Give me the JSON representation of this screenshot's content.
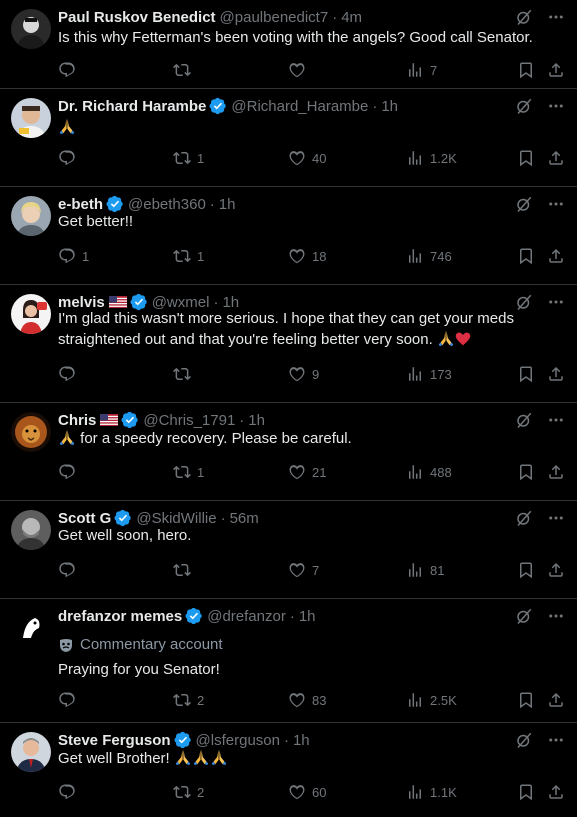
{
  "tweets": [
    {
      "name": "Paul Ruskov Benedict",
      "handle": "@paulbenedict7",
      "sep": "·",
      "time": "4m",
      "text": "Is this why Fetterman's been voting with the angels? Good call Senator.",
      "replies": "",
      "retweets": "",
      "likes": "",
      "views": "7",
      "verified": false
    },
    {
      "name": "Dr. Richard Harambe",
      "handle": "@Richard_Harambe",
      "sep": "·",
      "time": "1h",
      "text": "🙏",
      "replies": "",
      "retweets": "1",
      "likes": "40",
      "views": "1.2K",
      "verified": true
    },
    {
      "name": "e-beth",
      "handle": "@ebeth360",
      "sep": "·",
      "time": "1h",
      "text": "Get better!!",
      "replies": "1",
      "retweets": "1",
      "likes": "18",
      "views": "746",
      "verified": true
    },
    {
      "name": "melvis",
      "handle": "@wxmel",
      "sep": "·",
      "time": "1h",
      "text_line1": "I'm glad this wasn't more serious. I hope that they can get your meds",
      "text_line2": "straightened out and that you're feeling better very soon.",
      "replies": "",
      "retweets": "",
      "likes": "9",
      "views": "173",
      "verified": true
    },
    {
      "name": "Chris",
      "handle": "@Chris_1791",
      "sep": "·",
      "time": "1h",
      "text": "for a speedy recovery.  Please be careful.",
      "replies": "",
      "retweets": "1",
      "likes": "21",
      "views": "488",
      "verified": true
    },
    {
      "name": "Scott G",
      "handle": "@SkidWillie",
      "sep": "·",
      "time": "56m",
      "text": "Get well soon, hero.",
      "replies": "",
      "retweets": "",
      "likes": "7",
      "views": "81",
      "verified": true
    },
    {
      "name": "drefanzor memes",
      "handle": "@drefanzor",
      "sep": "·",
      "time": "1h",
      "commentary": "Commentary account",
      "text": "Praying for you Senator!",
      "replies": "",
      "retweets": "2",
      "likes": "83",
      "views": "2.5K",
      "verified": true
    },
    {
      "name": "Steve Ferguson",
      "handle": "@lsferguson",
      "sep": "·",
      "time": "1h",
      "text": "Get well Brother!",
      "replies": "",
      "retweets": "2",
      "likes": "60",
      "views": "1.1K",
      "verified": true
    }
  ],
  "colors": {
    "background": "#000000",
    "text": "#e7e9ea",
    "muted": "#71767b",
    "verified": "#1d9bf0",
    "divider": "#2f3336"
  },
  "icons": [
    "reply-icon",
    "retweet-icon",
    "like-icon",
    "views-icon",
    "bookmark-icon",
    "share-icon",
    "grok-icon",
    "more-icon",
    "verified-badge-icon"
  ]
}
